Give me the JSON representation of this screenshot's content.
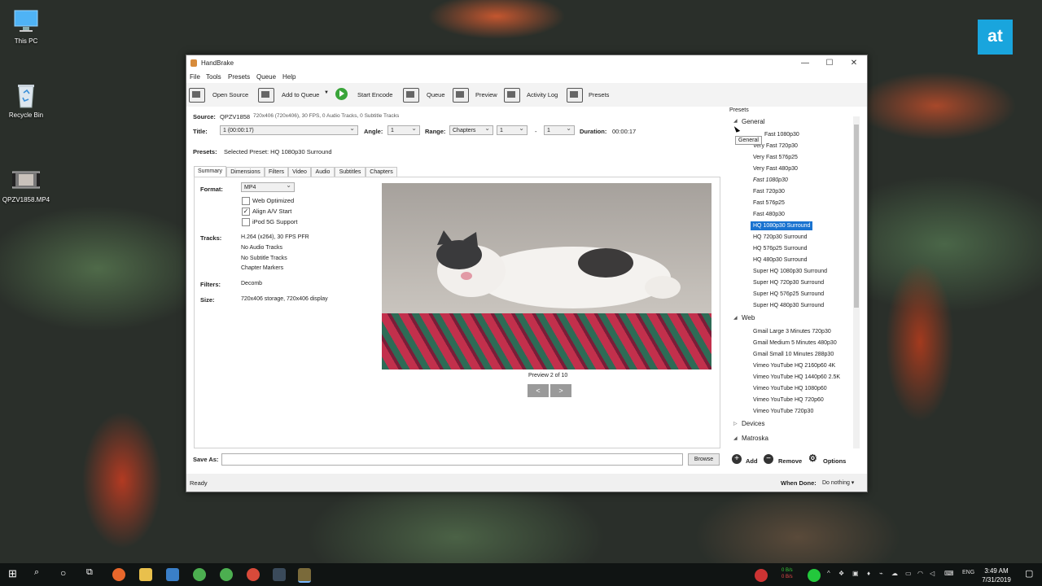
{
  "desktop": {
    "icons": [
      {
        "label": "This PC",
        "icon": "computer-icon"
      },
      {
        "label": "Recycle Bin",
        "icon": "recycle-bin-icon"
      },
      {
        "label": "QPZV1858.MP4",
        "icon": "video-file-icon"
      }
    ],
    "brand": "at"
  },
  "window": {
    "title": "HandBrake",
    "controls": {
      "minimize": "—",
      "maximize": "☐",
      "close": "✕"
    },
    "menu": [
      "File",
      "Tools",
      "Presets",
      "Queue",
      "Help"
    ],
    "toolbar": {
      "open_source": "Open Source",
      "add_to_queue": "Add to Queue",
      "start_encode": "Start Encode",
      "queue": "Queue",
      "preview": "Preview",
      "activity_log": "Activity Log",
      "presets": "Presets"
    },
    "source": {
      "label": "Source:",
      "name": "QPZV1858",
      "info": "720x406 (720x406), 30 FPS, 0 Audio Tracks, 0 Subtitle Tracks"
    },
    "title_row": {
      "title_label": "Title:",
      "title_value": "1 (00:00:17)",
      "angle_label": "Angle:",
      "angle_value": "1",
      "range_label": "Range:",
      "range_type": "Chapters",
      "range_start": "1",
      "range_sep": "-",
      "range_end": "1",
      "duration_label": "Duration:",
      "duration_value": "00:00:17"
    },
    "presets_row": {
      "label": "Presets:",
      "value": "Selected Preset: HQ 1080p30 Surround"
    },
    "tabs": [
      "Summary",
      "Dimensions",
      "Filters",
      "Video",
      "Audio",
      "Subtitles",
      "Chapters"
    ],
    "summary": {
      "format_label": "Format:",
      "format_value": "MP4",
      "checkboxes": [
        {
          "label": "Web Optimized",
          "checked": false
        },
        {
          "label": "Align A/V Start",
          "checked": true
        },
        {
          "label": "iPod 5G Support",
          "checked": false
        }
      ],
      "tracks_label": "Tracks:",
      "tracks": [
        "H.264 (x264), 30 FPS PFR",
        "No Audio Tracks",
        "No Subtitle Tracks",
        "Chapter Markers"
      ],
      "filters_label": "Filters:",
      "filters_value": "Decomb",
      "size_label": "Size:",
      "size_value": "720x406 storage, 720x406 display",
      "preview_caption": "Preview 2 of 10",
      "prev": "<",
      "next": ">"
    },
    "save_as": {
      "label": "Save As:",
      "value": "",
      "browse": "Browse"
    },
    "status": {
      "text": "Ready",
      "when_done_label": "When Done:",
      "when_done_value": "Do nothing ▾"
    }
  },
  "presets_panel": {
    "heading": "Presets",
    "tooltip": "General",
    "groups": [
      {
        "name": "General",
        "expanded": true,
        "items": [
          {
            "label": "Very Fast 1080p30",
            "visible_text": "Fast 1080p30"
          },
          {
            "label": "Very Fast 720p30"
          },
          {
            "label": "Very Fast 576p25"
          },
          {
            "label": "Very Fast 480p30"
          },
          {
            "label": "Fast 1080p30",
            "italic": true
          },
          {
            "label": "Fast 720p30"
          },
          {
            "label": "Fast 576p25"
          },
          {
            "label": "Fast 480p30"
          },
          {
            "label": "HQ 1080p30 Surround",
            "selected": true
          },
          {
            "label": "HQ 720p30 Surround"
          },
          {
            "label": "HQ 576p25 Surround"
          },
          {
            "label": "HQ 480p30 Surround"
          },
          {
            "label": "Super HQ 1080p30 Surround"
          },
          {
            "label": "Super HQ 720p30 Surround"
          },
          {
            "label": "Super HQ 576p25 Surround"
          },
          {
            "label": "Super HQ 480p30 Surround"
          }
        ]
      },
      {
        "name": "Web",
        "expanded": true,
        "items": [
          {
            "label": "Gmail Large 3 Minutes 720p30"
          },
          {
            "label": "Gmail Medium 5 Minutes 480p30"
          },
          {
            "label": "Gmail Small 10 Minutes 288p30"
          },
          {
            "label": "Vimeo YouTube HQ 2160p60 4K"
          },
          {
            "label": "Vimeo YouTube HQ 1440p60 2.5K"
          },
          {
            "label": "Vimeo YouTube HQ 1080p60"
          },
          {
            "label": "Vimeo YouTube HQ 720p60"
          },
          {
            "label": "Vimeo YouTube 720p30"
          }
        ]
      },
      {
        "name": "Devices",
        "expanded": false,
        "items": []
      },
      {
        "name": "Matroska",
        "expanded": true,
        "items": []
      }
    ],
    "actions": {
      "add": "Add",
      "remove": "Remove",
      "options": "Options"
    }
  },
  "taskbar": {
    "tray": {
      "net_up": "0 B/s",
      "net_down": "0 B/s",
      "lang": "ENG"
    },
    "time": "3:49 AM",
    "date": "7/31/2019"
  }
}
